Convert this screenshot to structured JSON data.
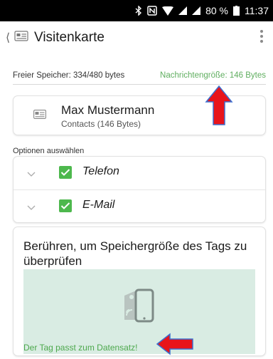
{
  "status_bar": {
    "battery_text": "80 %",
    "time": "11:37",
    "icons": [
      "bluetooth-icon",
      "nfc-icon",
      "wifi-icon",
      "signal-icon",
      "signal-icon",
      "battery-icon"
    ]
  },
  "app_bar": {
    "title": "Visitenkarte",
    "icons": [
      "back-icon",
      "contact-card-icon",
      "overflow-menu-icon"
    ]
  },
  "memory": {
    "free": "Freier Speicher: 334/480 bytes",
    "message_size": "Nachrichtengröße: 146 Bytes"
  },
  "contact": {
    "name": "Max Mustermann",
    "subtitle": "Contacts (146 Bytes)"
  },
  "options": {
    "label": "Optionen auswählen",
    "items": [
      {
        "label": "Telefon",
        "checked": true
      },
      {
        "label": "E-Mail",
        "checked": true
      }
    ]
  },
  "touch_check": {
    "headline": "Berühren, um Speichergröße des Tags zu überprüfen",
    "result": "Der Tag passt zum Datensatz!"
  },
  "colors": {
    "accent_green": "#5fae5f",
    "checkbox_green": "#4db84d",
    "panel_green": "#d9ece3",
    "annotation_red": "#e8141b"
  }
}
